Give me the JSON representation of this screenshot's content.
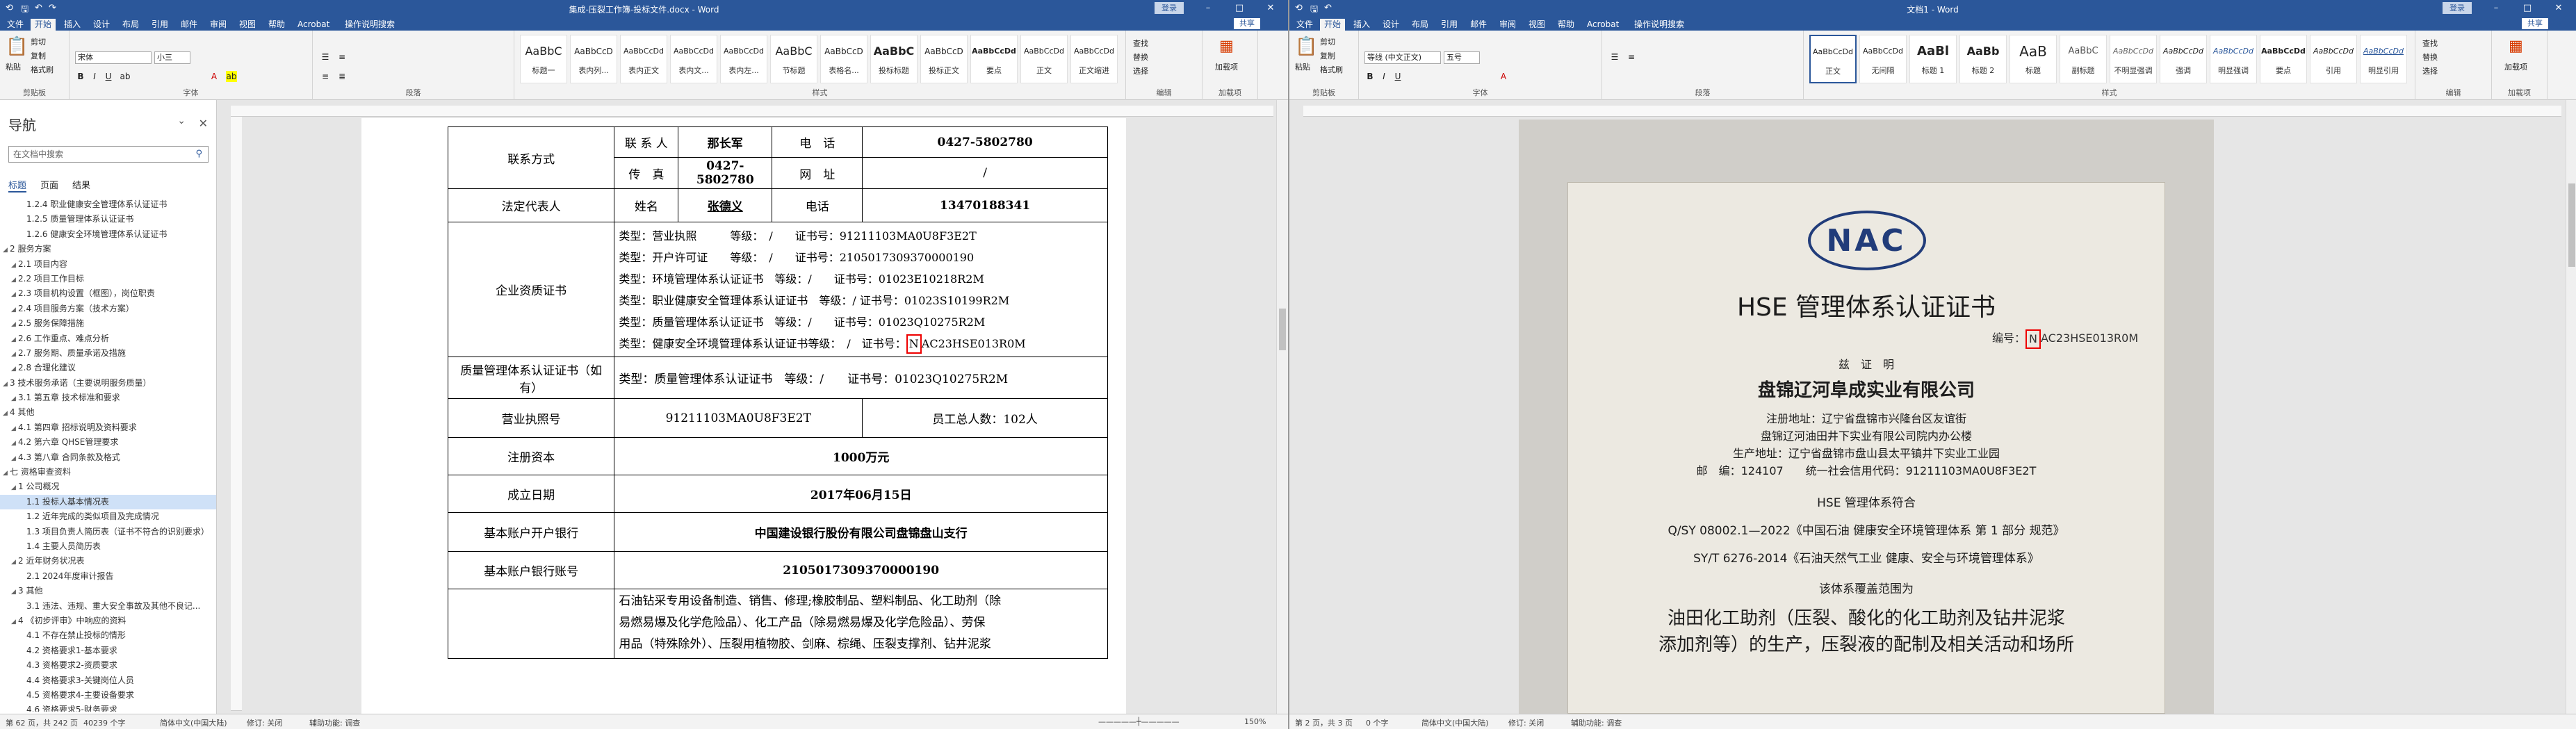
{
  "left": {
    "window_title": "集成-压裂工作簿-投标文件.docx - Word",
    "signin": "登录",
    "share": "共享",
    "tabs": [
      "文件",
      "开始",
      "插入",
      "设计",
      "布局",
      "引用",
      "邮件",
      "审阅",
      "视图",
      "帮助",
      "Acrobat",
      "操作说明搜索"
    ],
    "ribbon": {
      "paste": "粘贴",
      "cut": "剪切",
      "copy": "复制",
      "painter": "格式刷",
      "clipboard_group": "剪贴板",
      "font_name": "宋体",
      "font_size": "小三",
      "font_group": "字体",
      "para_group": "段落",
      "styles_group": "样式",
      "styles": [
        {
          "sample": "AaBbC",
          "name": "标题一"
        },
        {
          "sample": "AaBbCcD",
          "name": "表内列..."
        },
        {
          "sample": "AaBbCcDd",
          "name": "表内正文"
        },
        {
          "sample": "AaBbCcDd",
          "name": "表内文..."
        },
        {
          "sample": "AaBbCcDd",
          "name": "表内左..."
        },
        {
          "sample": "AaBbC",
          "name": "节标题"
        },
        {
          "sample": "AaBbCcD",
          "name": "表格名..."
        },
        {
          "sample": "AaBbC",
          "name": "投标标题"
        },
        {
          "sample": "AaBbCcD",
          "name": "投标正文"
        },
        {
          "sample": "AaBbCcDd",
          "name": "要点"
        },
        {
          "sample": "AaBbCcDd",
          "name": "正文"
        },
        {
          "sample": "AaBbCcDd",
          "name": "正文缩进"
        }
      ],
      "find": "查找",
      "replace": "替换",
      "select": "选择",
      "editing_group": "编辑",
      "addin": "加载项",
      "addin_group": "加载项"
    },
    "nav": {
      "title": "导航",
      "search_placeholder": "在文档中搜索",
      "tabs": [
        "标题",
        "页面",
        "结果"
      ],
      "items": [
        {
          "text": "1.2.4 职业健康安全管理体系认证证书",
          "level": 3,
          "sel": false
        },
        {
          "text": "1.2.5 质量管理体系认证证书",
          "level": 3,
          "sel": false
        },
        {
          "text": "1.2.6 健康安全环境管理体系认证证书",
          "level": 3,
          "sel": false
        },
        {
          "text": "2 服务方案",
          "level": 1,
          "sel": false
        },
        {
          "text": "2.1 项目内容",
          "level": 2,
          "sel": false
        },
        {
          "text": "2.2 项目工作目标",
          "level": 2,
          "sel": false
        },
        {
          "text": "2.3 项目机构设置（框图），岗位职责",
          "level": 2,
          "sel": false
        },
        {
          "text": "2.4 项目服务方案（技术方案）",
          "level": 2,
          "sel": false
        },
        {
          "text": "2.5 服务保障措施",
          "level": 2,
          "sel": false
        },
        {
          "text": "2.6 工作重点、难点分析",
          "level": 2,
          "sel": false
        },
        {
          "text": "2.7 服务期、质量承诺及措施",
          "level": 2,
          "sel": false
        },
        {
          "text": "2.8 合理化建议",
          "level": 2,
          "sel": false
        },
        {
          "text": "3 技术服务承诺（主要说明服务质量）",
          "level": 1,
          "sel": false
        },
        {
          "text": "3.1 第五章 技术标准和要求",
          "level": 2,
          "sel": false
        },
        {
          "text": "4 其他",
          "level": 1,
          "sel": false
        },
        {
          "text": "4.1 第四章 招标说明及资料要求",
          "level": 2,
          "sel": false
        },
        {
          "text": "4.2 第六章 QHSE管理要求",
          "level": 2,
          "sel": false
        },
        {
          "text": "4.3 第八章 合同条款及格式",
          "level": 2,
          "sel": false
        },
        {
          "text": "七 资格审查资料",
          "level": 1,
          "sel": false
        },
        {
          "text": "1 公司概况",
          "level": 2,
          "sel": false
        },
        {
          "text": "1.1 投标人基本情况表",
          "level": 3,
          "sel": true
        },
        {
          "text": "1.2 近年完成的类似项目及完成情况",
          "level": 3,
          "sel": false
        },
        {
          "text": "1.3 项目负责人简历表（证书不符合的识别要求）",
          "level": 3,
          "sel": false
        },
        {
          "text": "1.4 主要人员简历表",
          "level": 3,
          "sel": false
        },
        {
          "text": "2 近年财务状况表",
          "level": 2,
          "sel": false
        },
        {
          "text": "2.1 2024年度审计报告",
          "level": 3,
          "sel": false
        },
        {
          "text": "3 其他",
          "level": 2,
          "sel": false
        },
        {
          "text": "3.1 违法、违规、重大安全事故及其他不良记...",
          "level": 3,
          "sel": false
        },
        {
          "text": "4 《初步评审》中响应的资料",
          "level": 2,
          "sel": false
        },
        {
          "text": "4.1 不存在禁止投标的情形",
          "level": 3,
          "sel": false
        },
        {
          "text": "4.2 资格要求1-基本要求",
          "level": 3,
          "sel": false
        },
        {
          "text": "4.3 资格要求2-资质要求",
          "level": 3,
          "sel": false
        },
        {
          "text": "4.4 资格要求3-关键岗位人员",
          "level": 3,
          "sel": false
        },
        {
          "text": "4.5 资格要求4-主要设备要求",
          "level": 3,
          "sel": false
        },
        {
          "text": "4.6 资格要求5-财务要求",
          "level": 3,
          "sel": false
        }
      ]
    },
    "table": {
      "contact_method": "联系方式",
      "contact_person_label": "联 系 人",
      "contact_person": "那长军",
      "phone_label": "电　话",
      "phone": "0427-5802780",
      "fax_label": "传　真",
      "fax": "0427-5802780",
      "website_label": "网　址",
      "website": "/",
      "legal_rep_label": "法定代表人",
      "name_label": "姓名",
      "legal_rep_name": "张德义",
      "phone2_label": "电话",
      "legal_rep_phone": "13470188341",
      "qual_label": "企业资质证书",
      "qual_lines": [
        "类型：营业执照　　　等级：　/　　证书号：91211103MA0U8F3E2T",
        "类型：开户许可证　　等级：　/　　证书号：2105017309370000190",
        "类型：环境管理体系认证证书　等级：/　　证书号：01023E10218R2M",
        "类型：职业健康安全管理体系认证证书　等级：/ 证书号：01023S10199R2M",
        "类型：质量管理体系认证证书　等级：/　　证书号：01023Q10275R2M"
      ],
      "hse_line_prefix": "类型：健康安全环境管理体系认证证书等级：　/　证书号：",
      "hse_boxed_char": "N",
      "hse_line_suffix": "AC23HSE013R0M",
      "quality_cert_label": "质量管理体系认证证书（如有）",
      "quality_cert_line": "类型：质量管理体系认证证书　等级：/　　证书号：01023Q10275R2M",
      "license_label": "营业执照号",
      "license_no": "91211103MA0U8F3E2T",
      "staff_label": "员工总人数：102人",
      "capital_label": "注册资本",
      "capital": "1000万元",
      "founded_label": "成立日期",
      "founded": "2017年06月15日",
      "bank_label": "基本账户开户银行",
      "bank": "中国建设银行股份有限公司盘锦盘山支行",
      "account_label": "基本账户银行账号",
      "account": "2105017309370000190",
      "scope_lines": [
        "石油钻采专用设备制造、销售、修理;橡胶制品、塑料制品、化工助剂（除",
        "易燃易爆及化学危险品）、化工产品（除易燃易爆及化学危险品）、劳保",
        "用品（特殊除外）、压裂用植物胶、剑麻、棕绳、压裂支撑剂、钻井泥浆"
      ]
    },
    "status": {
      "page": "第 62 页，共 242 页",
      "words": "40239 个字",
      "lang": "简体中文(中国大陆)",
      "track": "修订: 关闭",
      "access": "辅助功能: 调查",
      "zoom": "150%"
    }
  },
  "right": {
    "window_title": "文档1 - Word",
    "signin": "登录",
    "share": "共享",
    "tabs": [
      "文件",
      "开始",
      "插入",
      "设计",
      "布局",
      "引用",
      "邮件",
      "审阅",
      "视图",
      "帮助",
      "Acrobat",
      "操作说明搜索"
    ],
    "ribbon": {
      "paste": "粘贴",
      "cut": "剪切",
      "copy": "复制",
      "painter": "格式刷",
      "clipboard_group": "剪贴板",
      "font_name": "等线 (中文正文)",
      "font_size": "五号",
      "font_group": "字体",
      "para_group": "段落",
      "styles_group": "样式",
      "styles": [
        {
          "sample": "AaBbCcDd",
          "name": "正文"
        },
        {
          "sample": "AaBbCcDd",
          "name": "无间隔"
        },
        {
          "sample": "AaBl",
          "name": "标题 1"
        },
        {
          "sample": "AaBb",
          "name": "标题 2"
        },
        {
          "sample": "AaB",
          "name": "标题"
        },
        {
          "sample": "AaBbC",
          "name": "副标题"
        },
        {
          "sample": "AaBbCcDd",
          "name": "不明显强调"
        },
        {
          "sample": "AaBbCcDd",
          "name": "强调"
        },
        {
          "sample": "AaBbCcDd",
          "name": "明显强调"
        },
        {
          "sample": "AaBbCcDd",
          "name": "要点"
        },
        {
          "sample": "AaBbCcDd",
          "name": "引用"
        },
        {
          "sample": "AaBbCcDd",
          "name": "明显引用"
        }
      ],
      "find": "查找",
      "replace": "替换",
      "select": "选择",
      "editing_group": "编辑",
      "addin": "加载项",
      "addin_group": "加载项"
    },
    "cert": {
      "logo": "NAC",
      "title": "HSE 管理体系认证证书",
      "number_label": "编号：",
      "number_boxed": "N",
      "number_rest": "AC23HSE013R0M",
      "subtitle": "兹　证　明",
      "company": "盘锦辽河阜成实业有限公司",
      "reg_addr": "注册地址：辽宁省盘锦市兴隆台区友谊街",
      "reg_addr2": "盘锦辽河油田井下实业有限公司院内办公楼",
      "prod_addr": "生产地址：辽宁省盘锦市盘山县太平镇井下实业工业园",
      "postcode": "邮　编：124107　　统一社会信用代码：91211103MA0U8F3E2T",
      "conform": "HSE 管理体系符合",
      "std1": "Q/SY 08002.1—2022《中国石油 健康安全环境管理体系 第 1 部分 规范》",
      "std2": "SY/T 6276-2014《石油天然气工业 健康、安全与环境管理体系》",
      "scope_label": "该体系覆盖范围为",
      "scope1": "油田化工助剂（压裂、酸化的化工助剂及钻井泥浆",
      "scope2": "添加剂等）的生产，压裂液的配制及相关活动和场所"
    },
    "status": {
      "page": "第 2 页，共 3 页",
      "words": "0 个字",
      "lang": "简体中文(中国大陆)",
      "track": "修订: 关闭",
      "access": "辅助功能: 调查"
    }
  }
}
